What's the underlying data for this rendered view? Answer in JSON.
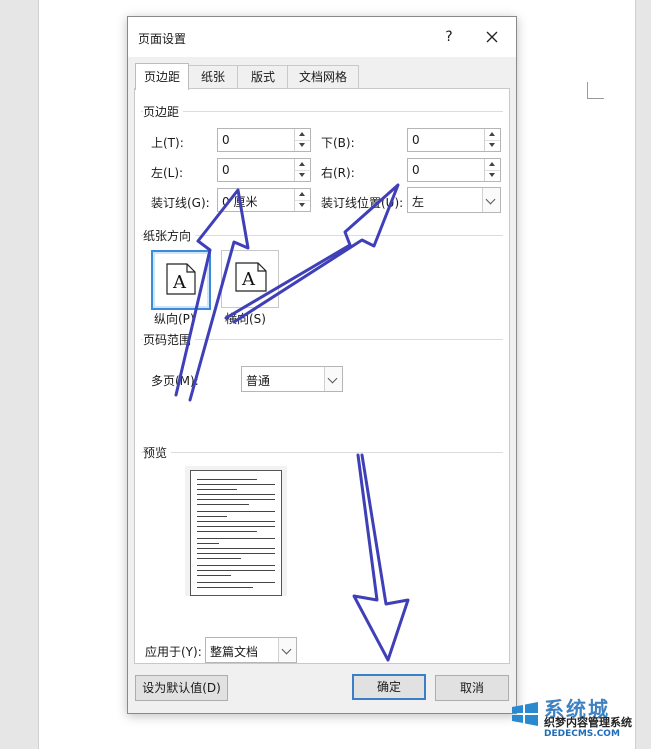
{
  "dialog": {
    "title": "页面设置",
    "help": "?",
    "tabs": [
      {
        "label": "页边距",
        "active": true
      },
      {
        "label": "纸张"
      },
      {
        "label": "版式"
      },
      {
        "label": "文档网格"
      }
    ]
  },
  "margins": {
    "section": "页边距",
    "top": {
      "label": "上(T):",
      "value": "0"
    },
    "bottom": {
      "label": "下(B):",
      "value": "0"
    },
    "left": {
      "label": "左(L):",
      "value": "0"
    },
    "right": {
      "label": "右(R):",
      "value": "0"
    },
    "gutter": {
      "label": "装订线(G):",
      "value": "0 厘米"
    },
    "gutter_pos": {
      "label": "装订线位置(U):",
      "value": "左"
    }
  },
  "orientation": {
    "section": "纸张方向",
    "portrait": "纵向(P)",
    "landscape": "横向(S)",
    "selected": "portrait"
  },
  "pages": {
    "section": "页码范围",
    "multiple_label": "多页(M):",
    "multiple_value": "普通"
  },
  "preview": {
    "section": "预览",
    "apply_label": "应用于(Y):",
    "apply_value": "整篇文档"
  },
  "buttons": {
    "default": "设为默认值(D)",
    "ok": "确定",
    "cancel": "取消"
  },
  "colors": {
    "accent": "#3c7fc9",
    "annotation_arrow": "#3f3fb8"
  },
  "watermark": {
    "brand": "系统城",
    "cn": "织梦内容管理系统",
    "en": "DEDECMS.COM"
  }
}
